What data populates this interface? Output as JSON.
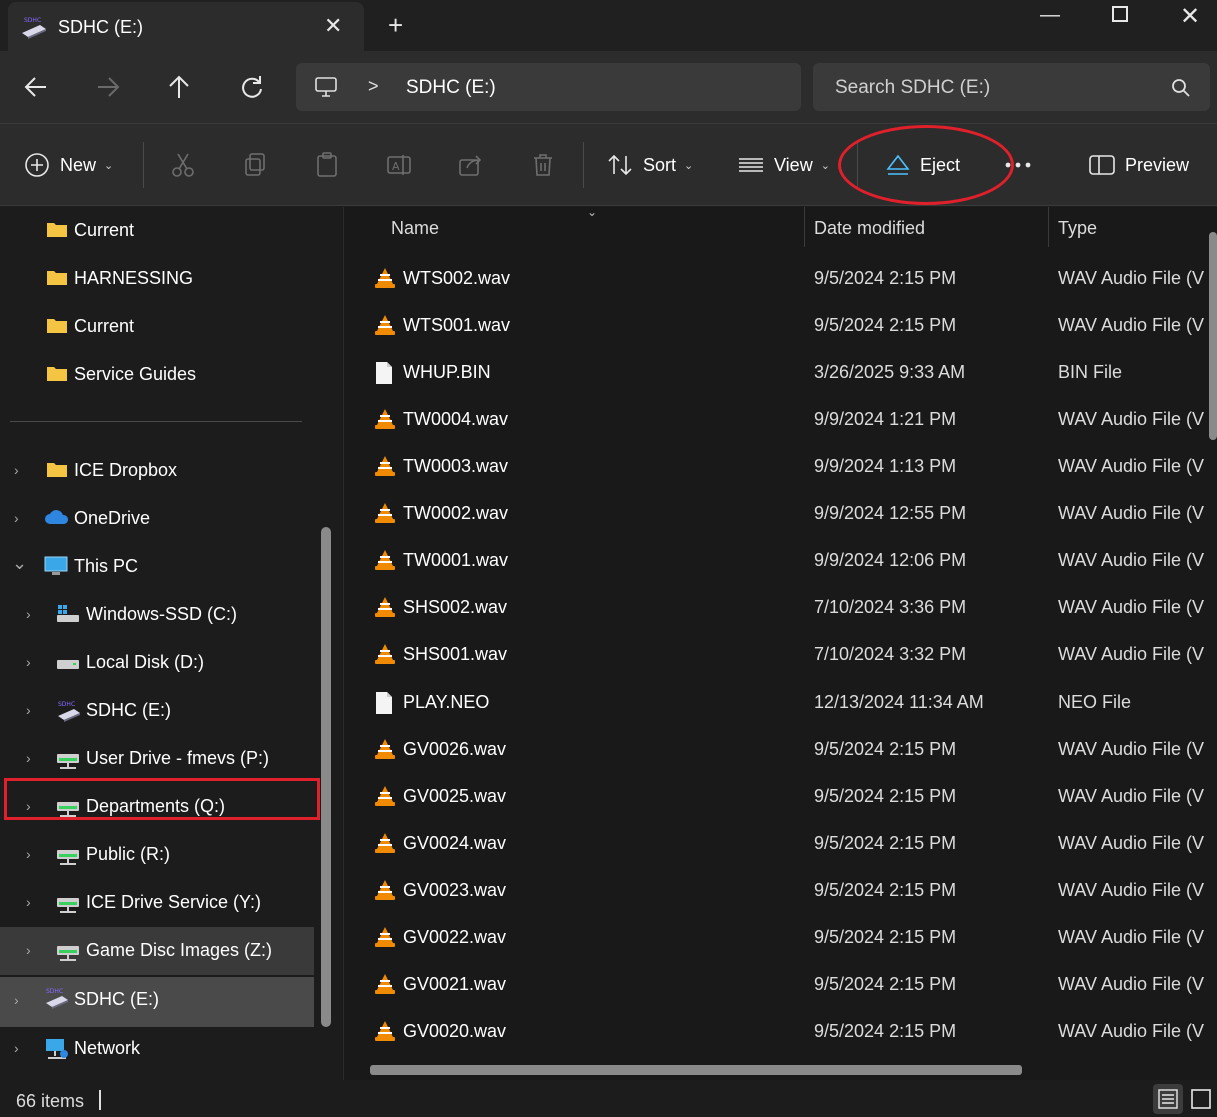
{
  "window": {
    "tab_title": "SDHC (E:)",
    "new_tab_label": "+",
    "close_tab_label": "✕"
  },
  "address": {
    "crumb": "SDHC (E:)",
    "separator": ">"
  },
  "search": {
    "placeholder": "Search SDHC (E:)"
  },
  "toolbar": {
    "new_label": "New",
    "sort_label": "Sort",
    "view_label": "View",
    "eject_label": "Eject",
    "preview_label": "Preview"
  },
  "sidebar": {
    "quick_access": [
      {
        "label": "Current",
        "icon": "folder-icon"
      },
      {
        "label": "HARNESSING",
        "icon": "folder-icon"
      },
      {
        "label": "Current",
        "icon": "folder-icon"
      },
      {
        "label": "Service Guides",
        "icon": "folder-icon"
      }
    ],
    "tree": [
      {
        "label": "ICE Dropbox",
        "icon": "folder-icon",
        "chevron": "›"
      },
      {
        "label": "OneDrive",
        "icon": "cloud-icon",
        "chevron": "›"
      },
      {
        "label": "This PC",
        "icon": "monitor-icon",
        "chevron": "⌄"
      },
      {
        "label": "Windows-SSD (C:)",
        "icon": "windows-drive-icon",
        "chevron": "›"
      },
      {
        "label": "Local Disk (D:)",
        "icon": "drive-icon",
        "chevron": "›"
      },
      {
        "label": "SDHC (E:)",
        "icon": "sdcard-icon",
        "chevron": "›"
      },
      {
        "label": "User Drive - fmevs (P:)",
        "icon": "network-drive-icon",
        "chevron": "›"
      },
      {
        "label": "Departments (Q:)",
        "icon": "network-drive-icon",
        "chevron": "›"
      },
      {
        "label": "Public (R:)",
        "icon": "network-drive-icon",
        "chevron": "›"
      },
      {
        "label": "ICE Drive Service (Y:)",
        "icon": "network-drive-icon",
        "chevron": "›"
      },
      {
        "label": "Game Disc Images (Z:)",
        "icon": "network-drive-icon",
        "chevron": "›"
      },
      {
        "label": "SDHC (E:)",
        "icon": "sdcard-icon",
        "chevron": "›"
      },
      {
        "label": "Network",
        "icon": "network-icon",
        "chevron": "›"
      }
    ]
  },
  "columns": {
    "name": "Name",
    "date": "Date modified",
    "type": "Type"
  },
  "files": [
    {
      "name": "WTS002.wav",
      "date": "9/5/2024 2:15 PM",
      "type": "WAV Audio File (V",
      "icon": "vlc-cone-icon"
    },
    {
      "name": "WTS001.wav",
      "date": "9/5/2024 2:15 PM",
      "type": "WAV Audio File (V",
      "icon": "vlc-cone-icon"
    },
    {
      "name": "WHUP.BIN",
      "date": "3/26/2025 9:33 AM",
      "type": "BIN File",
      "icon": "file-icon"
    },
    {
      "name": "TW0004.wav",
      "date": "9/9/2024 1:21 PM",
      "type": "WAV Audio File (V",
      "icon": "vlc-cone-icon"
    },
    {
      "name": "TW0003.wav",
      "date": "9/9/2024 1:13 PM",
      "type": "WAV Audio File (V",
      "icon": "vlc-cone-icon"
    },
    {
      "name": "TW0002.wav",
      "date": "9/9/2024 12:55 PM",
      "type": "WAV Audio File (V",
      "icon": "vlc-cone-icon"
    },
    {
      "name": "TW0001.wav",
      "date": "9/9/2024 12:06 PM",
      "type": "WAV Audio File (V",
      "icon": "vlc-cone-icon"
    },
    {
      "name": "SHS002.wav",
      "date": "7/10/2024 3:36 PM",
      "type": "WAV Audio File (V",
      "icon": "vlc-cone-icon"
    },
    {
      "name": "SHS001.wav",
      "date": "7/10/2024 3:32 PM",
      "type": "WAV Audio File (V",
      "icon": "vlc-cone-icon"
    },
    {
      "name": "PLAY.NEO",
      "date": "12/13/2024 11:34 AM",
      "type": "NEO File",
      "icon": "file-icon"
    },
    {
      "name": "GV0026.wav",
      "date": "9/5/2024 2:15 PM",
      "type": "WAV Audio File (V",
      "icon": "vlc-cone-icon"
    },
    {
      "name": "GV0025.wav",
      "date": "9/5/2024 2:15 PM",
      "type": "WAV Audio File (V",
      "icon": "vlc-cone-icon"
    },
    {
      "name": "GV0024.wav",
      "date": "9/5/2024 2:15 PM",
      "type": "WAV Audio File (V",
      "icon": "vlc-cone-icon"
    },
    {
      "name": "GV0023.wav",
      "date": "9/5/2024 2:15 PM",
      "type": "WAV Audio File (V",
      "icon": "vlc-cone-icon"
    },
    {
      "name": "GV0022.wav",
      "date": "9/5/2024 2:15 PM",
      "type": "WAV Audio File (V",
      "icon": "vlc-cone-icon"
    },
    {
      "name": "GV0021.wav",
      "date": "9/5/2024 2:15 PM",
      "type": "WAV Audio File (V",
      "icon": "vlc-cone-icon"
    },
    {
      "name": "GV0020.wav",
      "date": "9/5/2024 2:15 PM",
      "type": "WAV Audio File (V",
      "icon": "vlc-cone-icon"
    }
  ],
  "status": {
    "item_count": "66 items"
  },
  "colors": {
    "background": "#1c1c1c",
    "chrome": "#2c2c2c",
    "accent": "#4cc2ff",
    "annotation_red": "#e0202a",
    "folder": "#f4c542",
    "vlc_orange": "#f08a00"
  }
}
